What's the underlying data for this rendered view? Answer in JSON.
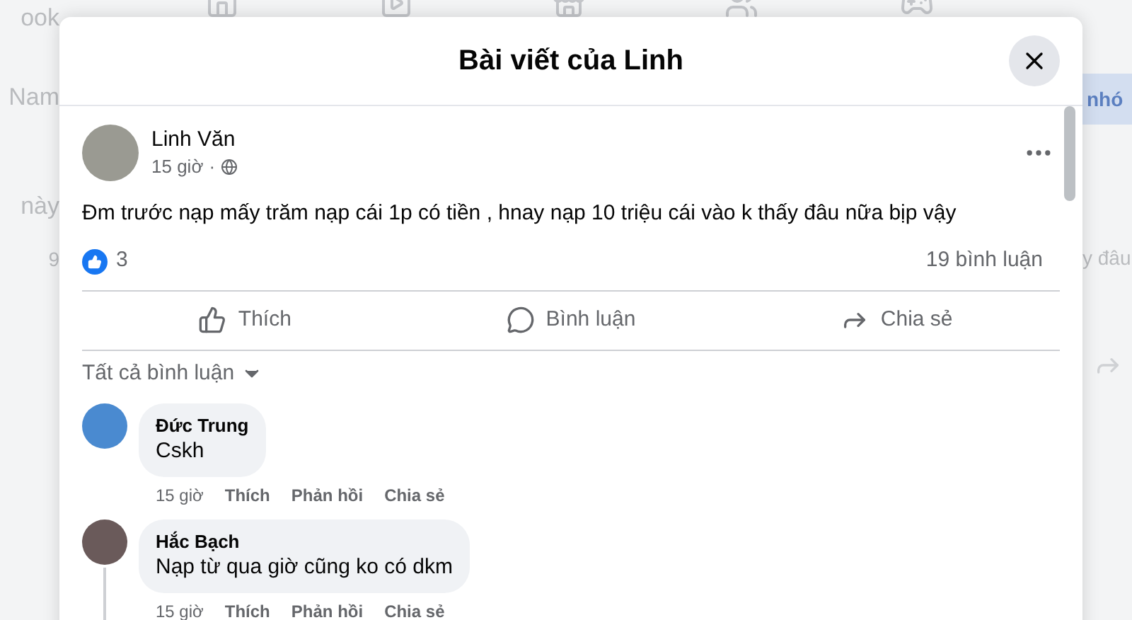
{
  "background": {
    "left_texts": [
      "ook",
      "Nam",
      "này",
      "9"
    ],
    "group_button": "nhó",
    "right_text": "y đâu"
  },
  "dialog": {
    "title": "Bài viết của Linh"
  },
  "post": {
    "author": "Linh Văn",
    "time": "15 giờ",
    "separator": "·",
    "text": "Đm trước nạp mấy trăm nạp cái 1p có tiền , hnay nạp 10 triệu cái vào k thấy đâu nữa bịp vậy",
    "like_count": "3",
    "comment_count": "19 bình luận",
    "actions": [
      {
        "kind": "like",
        "label": "Thích"
      },
      {
        "kind": "comment",
        "label": "Bình luận"
      },
      {
        "kind": "share",
        "label": "Chia sẻ"
      }
    ]
  },
  "comments_filter": "Tất cả bình luận",
  "comments": [
    {
      "author": "Đức Trung",
      "text": "Cskh",
      "time": "15 giờ",
      "actions": [
        "Thích",
        "Phản hồi",
        "Chia sẻ"
      ],
      "has_replies": false
    },
    {
      "author": "Hắc Bạch",
      "text": "Nạp từ qua giờ cũng ko có dkm",
      "time": "15 giờ",
      "actions": [
        "Thích",
        "Phản hồi",
        "Chia sẻ"
      ],
      "has_replies": true
    }
  ]
}
